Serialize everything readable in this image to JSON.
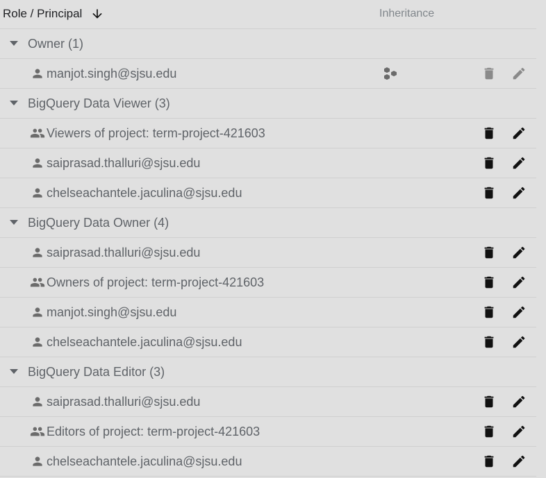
{
  "header": {
    "role_principal": "Role / Principal",
    "inheritance": "Inheritance"
  },
  "colors": {
    "icon_active": "#111111",
    "icon_disabled": "#8a8a8a",
    "principal_icon": "#6b6b6b"
  },
  "groups": [
    {
      "label": "Owner (1)",
      "rows": [
        {
          "type": "user-icon",
          "name": "manjot.singh@sjsu.edu",
          "inherited": true,
          "disabled": true
        }
      ]
    },
    {
      "label": "BigQuery Data Viewer (3)",
      "rows": [
        {
          "type": "group-icon",
          "name": "Viewers of project: term-project-421603",
          "inherited": false,
          "disabled": false
        },
        {
          "type": "user-icon",
          "name": "saiprasad.thalluri@sjsu.edu",
          "inherited": false,
          "disabled": false
        },
        {
          "type": "user-icon",
          "name": "chelseachantele.jaculina@sjsu.edu",
          "inherited": false,
          "disabled": false
        }
      ]
    },
    {
      "label": "BigQuery Data Owner (4)",
      "rows": [
        {
          "type": "user-icon",
          "name": "saiprasad.thalluri@sjsu.edu",
          "inherited": false,
          "disabled": false
        },
        {
          "type": "group-icon",
          "name": "Owners of project: term-project-421603",
          "inherited": false,
          "disabled": false
        },
        {
          "type": "user-icon",
          "name": "manjot.singh@sjsu.edu",
          "inherited": false,
          "disabled": false
        },
        {
          "type": "user-icon",
          "name": "chelseachantele.jaculina@sjsu.edu",
          "inherited": false,
          "disabled": false
        }
      ]
    },
    {
      "label": "BigQuery Data Editor (3)",
      "rows": [
        {
          "type": "user-icon",
          "name": "saiprasad.thalluri@sjsu.edu",
          "inherited": false,
          "disabled": false
        },
        {
          "type": "group-icon",
          "name": "Editors of project: term-project-421603",
          "inherited": false,
          "disabled": false
        },
        {
          "type": "user-icon",
          "name": "chelseachantele.jaculina@sjsu.edu",
          "inherited": false,
          "disabled": false
        }
      ]
    }
  ]
}
